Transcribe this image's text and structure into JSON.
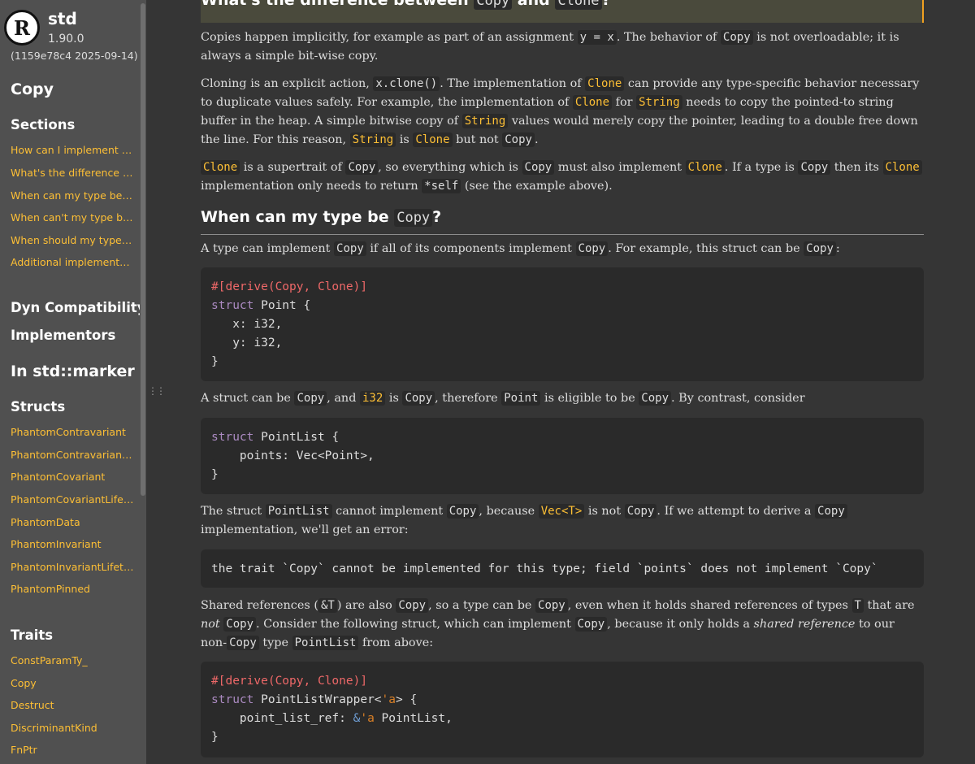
{
  "sidebar": {
    "logo_letter": "R",
    "crate_name": "std",
    "version": "1.90.0",
    "build": "(1159e78c4 2025-09-14)",
    "item_title": "Copy",
    "sections_heading": "Sections",
    "sections": [
      "How can I implement Copy?",
      "What's the difference between Copy and Clone?",
      "When can my type be Copy?",
      "When can't my type be Copy?",
      "When should my type be Copy?",
      "Additional implementors"
    ],
    "dyn_compat": "Dyn Compatibility",
    "implementors": "Implementors",
    "module_heading": "In std::marker",
    "structs_heading": "Structs",
    "structs": [
      "PhantomContravariant",
      "PhantomContravariantLifetime",
      "PhantomCovariant",
      "PhantomCovariantLifetime",
      "PhantomData",
      "PhantomInvariant",
      "PhantomInvariantLifetime",
      "PhantomPinned"
    ],
    "traits_heading": "Traits",
    "traits": [
      "ConstParamTy_",
      "Copy",
      "Destruct",
      "DiscriminantKind",
      "FnPtr"
    ]
  },
  "content": {
    "h_diff": {
      "pre": "What's the difference between ",
      "c1": "Copy",
      "mid": " and ",
      "c2": "Clone",
      "post": "?"
    },
    "p1": {
      "t1": "Copies happen implicitly, for example as part of an assignment ",
      "c1": "y = x",
      "t2": ". The behavior of ",
      "c2": "Copy",
      "t3": " is not overloadable; it is always a simple bit-wise copy."
    },
    "p2": {
      "t1": "Cloning is an explicit action, ",
      "c1": "x.clone()",
      "t2": ". The implementation of ",
      "c2": "Clone",
      "t3": " can provide any type-specific behavior necessary to duplicate values safely. For example, the implementation of ",
      "c3": "Clone",
      "t4": " for ",
      "c4": "String",
      "t5": " needs to copy the pointed-to string buffer in the heap. A simple bitwise copy of ",
      "c5": "String",
      "t6": " values would merely copy the pointer, leading to a double free down the line. For this reason, ",
      "c6": "String",
      "t7": " is ",
      "c7": "Clone",
      "t8": " but not ",
      "c8": "Copy",
      "t9": "."
    },
    "p3": {
      "c1": "Clone",
      "t1": " is a supertrait of ",
      "c2": "Copy",
      "t2": ", so everything which is ",
      "c3": "Copy",
      "t3": " must also implement ",
      "c4": "Clone",
      "t4": ". If a type is ",
      "c5": "Copy",
      "t5": " then its ",
      "c6": "Clone",
      "t6": " implementation only needs to return ",
      "c7": "*self",
      "t7": " (see the example above)."
    },
    "h_when": {
      "pre": "When can my type be ",
      "c1": "Copy",
      "post": "?"
    },
    "p4": {
      "t1": "A type can implement ",
      "c1": "Copy",
      "t2": " if all of its components implement ",
      "c2": "Copy",
      "t3": ". For example, this struct can be ",
      "c3": "Copy",
      "t4": ":"
    },
    "code1": {
      "attr": "#[derive(Copy, Clone)]",
      "kw": "struct",
      "name": " Point {",
      "l3": "   x: i32,",
      "l4": "   y: i32,",
      "l5": "}"
    },
    "p5": {
      "t1": "A struct can be ",
      "c1": "Copy",
      "t2": ", and ",
      "c2": "i32",
      "t3": " is ",
      "c3": "Copy",
      "t4": ", therefore ",
      "c4": "Point",
      "t5": " is eligible to be ",
      "c5": "Copy",
      "t6": ". By contrast, consider"
    },
    "code2": {
      "kw": "struct",
      "name": " PointList {",
      "l2": "    points: Vec<Point>,",
      "l3": "}"
    },
    "p6": {
      "t1": "The struct ",
      "c1": "PointList",
      "t2": " cannot implement ",
      "c2": "Copy",
      "t3": ", because ",
      "c3": "Vec<T>",
      "t4": " is not ",
      "c4": "Copy",
      "t5": ". If we attempt to derive a ",
      "c5": "Copy",
      "t6": " implementation, we'll get an error:"
    },
    "code3": "the trait `Copy` cannot be implemented for this type; field `points` does not implement `Copy`",
    "p7": {
      "t1": "Shared references (",
      "c1": "&T",
      "t2": ") are also ",
      "c2": "Copy",
      "t3": ", so a type can be ",
      "c3": "Copy",
      "t4": ", even when it holds shared references of types ",
      "c4": "T",
      "t5": " that are ",
      "em1": "not",
      "t6": " ",
      "c5": "Copy",
      "t7": ". Consider the following struct, which can implement ",
      "c6": "Copy",
      "t8": ", because it only holds a ",
      "em2": "shared reference",
      "t9": " to our non-",
      "c7": "Copy",
      "t10": " type ",
      "c8": "PointList",
      "t11": " from above:"
    },
    "code4": {
      "attr": "#[derive(Copy, Clone)]",
      "kw": "struct",
      "name": " PointListWrapper<",
      "life": "'a",
      "name_end": "> {",
      "l3a": "    point_list_ref: ",
      "l3b": "&",
      "l3c": "'a",
      "l3d": " PointList,",
      "l4": "}"
    }
  },
  "colors": {
    "sidebar_bg": "#505050",
    "main_bg": "#353535",
    "link": "#fdbf35",
    "code_bg": "#2a2a2a",
    "keyword": "#ab8ac1",
    "attribute": "#ee6868"
  }
}
